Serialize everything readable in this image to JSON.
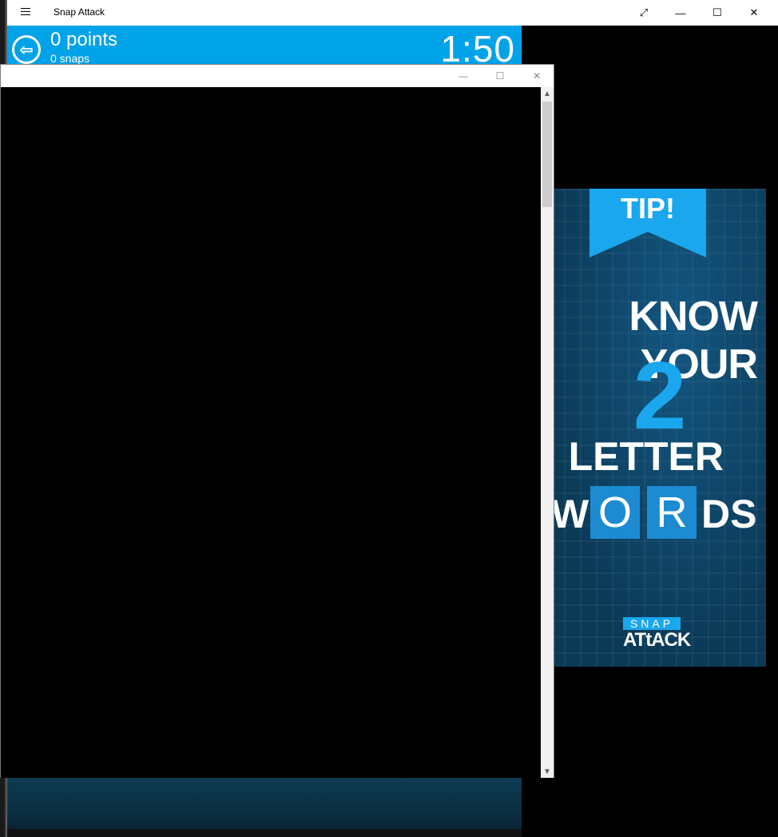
{
  "app": {
    "title": "Snap Attack",
    "controls": {
      "expand": "⤢",
      "minimize": "—",
      "maximize": "☐",
      "close": "✕"
    }
  },
  "game": {
    "back_icon": "⇦",
    "points_label": "0 points",
    "snaps_label": "0 snaps",
    "timer": "1:50"
  },
  "ad": {
    "banner": "TIP!",
    "line1": "KNOW YOUR",
    "number": "2",
    "line2": "LETTER",
    "word_w": "W",
    "word_o": "O",
    "word_r": "R",
    "word_ds": "DS",
    "logo_top": "SNAP",
    "logo_bottom": "ATtACK"
  },
  "popup": {
    "minimize": "—",
    "maximize": "☐",
    "close": "✕",
    "scroll_up": "▲",
    "scroll_down": "▼"
  },
  "colors": {
    "accent": "#00a2e8",
    "ad_bg": "#0b3a57",
    "ad_blue": "#1aa7ee"
  }
}
